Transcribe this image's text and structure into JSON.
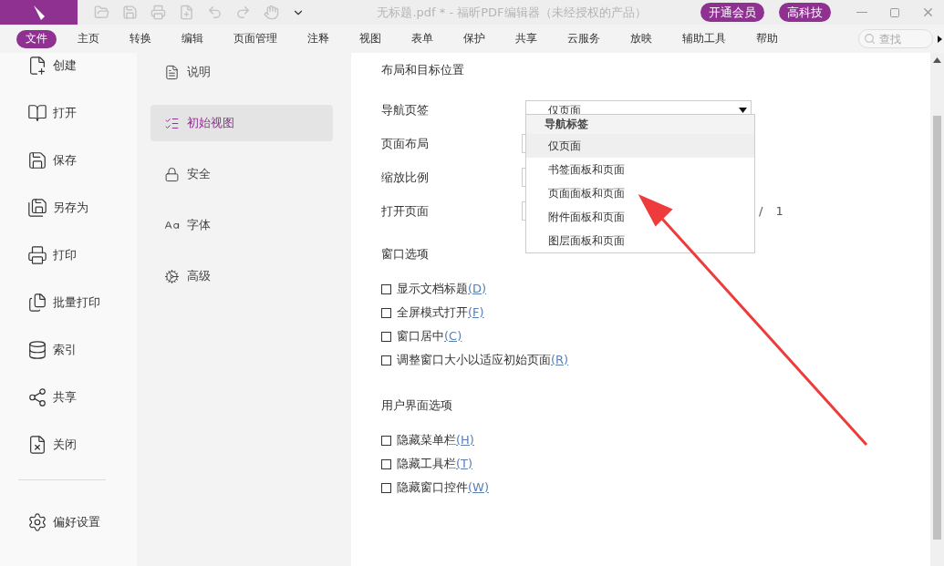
{
  "window": {
    "title": "无标题.pdf * - 福昕PDF编辑器（未经授权的产品）",
    "buttons": [
      "开通会员",
      "高科技"
    ]
  },
  "menu": [
    {
      "label": "文件",
      "selected": true
    },
    {
      "label": "主页",
      "selected": false
    },
    {
      "label": "转换",
      "selected": false
    },
    {
      "label": "编辑",
      "selected": false
    },
    {
      "label": "页面管理",
      "selected": false
    },
    {
      "label": "注释",
      "selected": false
    },
    {
      "label": "视图",
      "selected": false
    },
    {
      "label": "表单",
      "selected": false
    },
    {
      "label": "保护",
      "selected": false
    },
    {
      "label": "共享",
      "selected": false
    },
    {
      "label": "云服务",
      "selected": false
    },
    {
      "label": "放映",
      "selected": false
    },
    {
      "label": "辅助工具",
      "selected": false
    },
    {
      "label": "帮助",
      "selected": false
    }
  ],
  "search": {
    "placeholder": "查找"
  },
  "sidebar": {
    "items": [
      "创建",
      "打开",
      "保存",
      "另存为",
      "打印",
      "批量打印",
      "索引",
      "共享",
      "关闭"
    ],
    "footer": "偏好设置"
  },
  "categories": [
    {
      "label": "说明",
      "selected": false
    },
    {
      "label": "初始视图",
      "selected": true
    },
    {
      "label": "安全",
      "selected": false
    },
    {
      "label": "字体",
      "selected": false
    },
    {
      "label": "高级",
      "selected": false
    }
  ],
  "layout_section": {
    "title": "布局和目标位置",
    "fields": [
      {
        "label": "导航页签",
        "value": "仅页面"
      },
      {
        "label": "页面布局"
      },
      {
        "label": "缩放比例"
      },
      {
        "label": "打开页面",
        "page_separator": "/",
        "page_total": "1"
      }
    ]
  },
  "dropdown": {
    "header": "导航标签",
    "options": [
      {
        "label": "仅页面",
        "selected": true
      },
      {
        "label": "书签面板和页面",
        "selected": false
      },
      {
        "label": "页面面板和页面",
        "selected": false
      },
      {
        "label": "附件面板和页面",
        "selected": false
      },
      {
        "label": "图层面板和页面",
        "selected": false
      }
    ]
  },
  "window_section": {
    "title": "窗口选项",
    "options": [
      {
        "label": "显示文档标题",
        "shortcut": "(D)",
        "checked": false
      },
      {
        "label": "全屏模式打开",
        "shortcut": "(F)",
        "checked": false
      },
      {
        "label": "窗口居中",
        "shortcut": "(C)",
        "checked": false
      },
      {
        "label": "调整窗口大小以适应初始页面",
        "shortcut": "(R)",
        "checked": false
      }
    ]
  },
  "ui_section": {
    "title": "用户界面选项",
    "options": [
      {
        "label": "隐藏菜单栏",
        "shortcut": "(H)",
        "checked": false
      },
      {
        "label": "隐藏工具栏",
        "shortcut": "(T)",
        "checked": false
      },
      {
        "label": "隐藏窗口控件",
        "shortcut": "(W)",
        "checked": false
      }
    ]
  }
}
